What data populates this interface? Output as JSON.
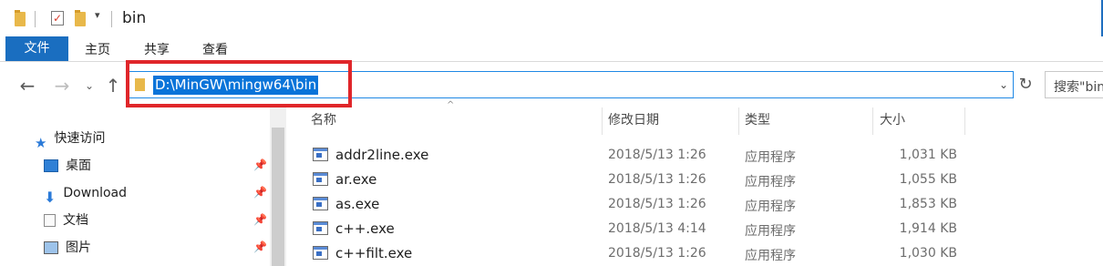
{
  "window": {
    "title": "bin"
  },
  "ribbon": {
    "file_tab": "文件",
    "tabs": [
      "主页",
      "共享",
      "查看"
    ]
  },
  "nav": {
    "address": "D:\\MinGW\\mingw64\\bin",
    "search_placeholder": "搜索\"bin\"",
    "accent": "#1a6ec0",
    "highlight": "#e0262a"
  },
  "sidebar": {
    "quick_access": "快速访问",
    "items": [
      {
        "label": "桌面",
        "icon": "desktop-icon",
        "pinned": true
      },
      {
        "label": "Download",
        "icon": "download-icon",
        "pinned": true
      },
      {
        "label": "文档",
        "icon": "documents-icon",
        "pinned": true
      },
      {
        "label": "图片",
        "icon": "pictures-icon",
        "pinned": true
      }
    ]
  },
  "columns": {
    "name": "名称",
    "modified": "修改日期",
    "type": "类型",
    "size": "大小"
  },
  "files": [
    {
      "name": "addr2line.exe",
      "modified": "2018/5/13 1:26",
      "type": "应用程序",
      "size": "1,031 KB"
    },
    {
      "name": "ar.exe",
      "modified": "2018/5/13 1:26",
      "type": "应用程序",
      "size": "1,055 KB"
    },
    {
      "name": "as.exe",
      "modified": "2018/5/13 1:26",
      "type": "应用程序",
      "size": "1,853 KB"
    },
    {
      "name": "c++.exe",
      "modified": "2018/5/13 4:14",
      "type": "应用程序",
      "size": "1,914 KB"
    },
    {
      "name": "c++filt.exe",
      "modified": "2018/5/13 1:26",
      "type": "应用程序",
      "size": "1,030 KB"
    }
  ]
}
